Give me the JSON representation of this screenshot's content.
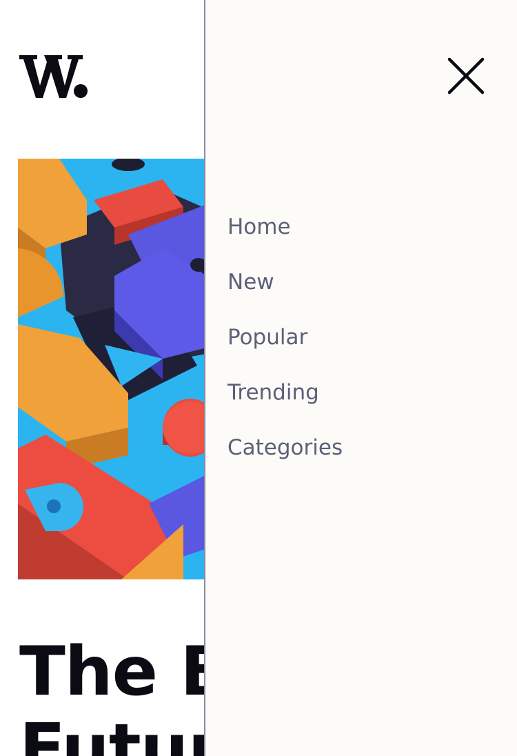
{
  "header": {
    "logo_text": "W.",
    "logo_icon": "wordmark-w-logo"
  },
  "hero": {
    "image_icon": "abstract-3d-blocks-illustration"
  },
  "article": {
    "headline_line1": "The B",
    "headline_line2": "Futur"
  },
  "drawer": {
    "close_icon": "close-icon",
    "menu_items": [
      {
        "label": "Home"
      },
      {
        "label": "New"
      },
      {
        "label": "Popular"
      },
      {
        "label": "Trending"
      },
      {
        "label": "Categories"
      }
    ]
  },
  "colors": {
    "drawer_background": "#fcfbf8",
    "menu_text": "#5c6078",
    "ink": "#0b0b14"
  }
}
